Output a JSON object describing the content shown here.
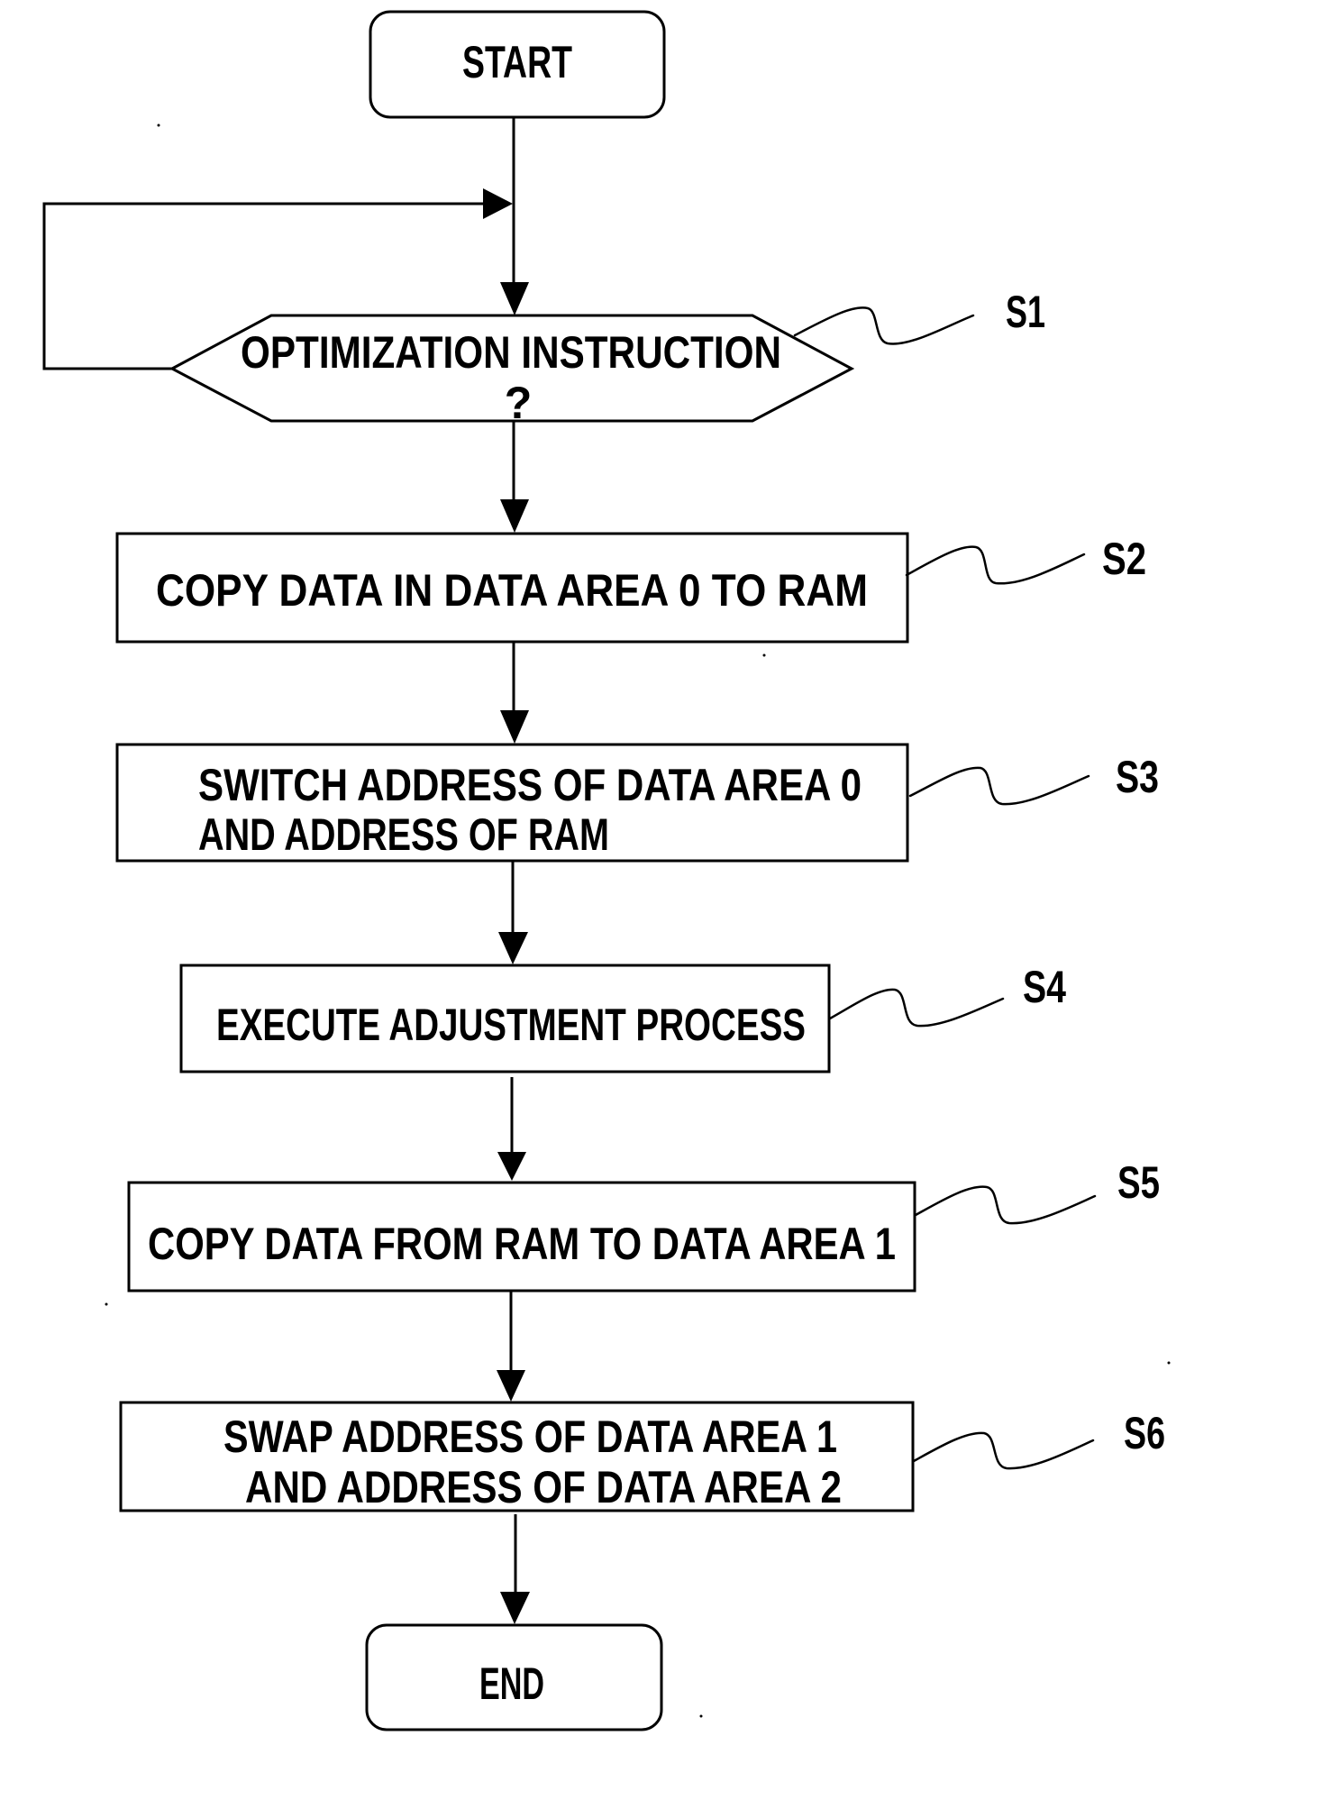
{
  "diagram": {
    "type": "flowchart",
    "terminals": {
      "start": "START",
      "end": "END"
    },
    "steps": [
      {
        "id": "S1",
        "kind": "decision",
        "lines": [
          "OPTIMIZATION INSTRUCTION",
          "?"
        ],
        "loop_back": "no-branch returns to decision input"
      },
      {
        "id": "S2",
        "kind": "process",
        "lines": [
          "COPY DATA IN DATA AREA 0 TO RAM"
        ]
      },
      {
        "id": "S3",
        "kind": "process",
        "lines": [
          "SWITCH ADDRESS OF DATA AREA 0",
          "AND ADDRESS OF RAM"
        ]
      },
      {
        "id": "S4",
        "kind": "process",
        "lines": [
          "EXECUTE ADJUSTMENT PROCESS"
        ]
      },
      {
        "id": "S5",
        "kind": "process",
        "lines": [
          "COPY DATA FROM RAM TO DATA AREA 1"
        ]
      },
      {
        "id": "S6",
        "kind": "process",
        "lines": [
          "SWAP ADDRESS OF DATA AREA 1",
          "AND ADDRESS OF DATA AREA 2"
        ]
      }
    ],
    "flow": [
      "START",
      "S1",
      "S2",
      "S3",
      "S4",
      "S5",
      "S6",
      "END"
    ],
    "colors": {
      "ink": "#000000",
      "paper": "#ffffff"
    }
  }
}
